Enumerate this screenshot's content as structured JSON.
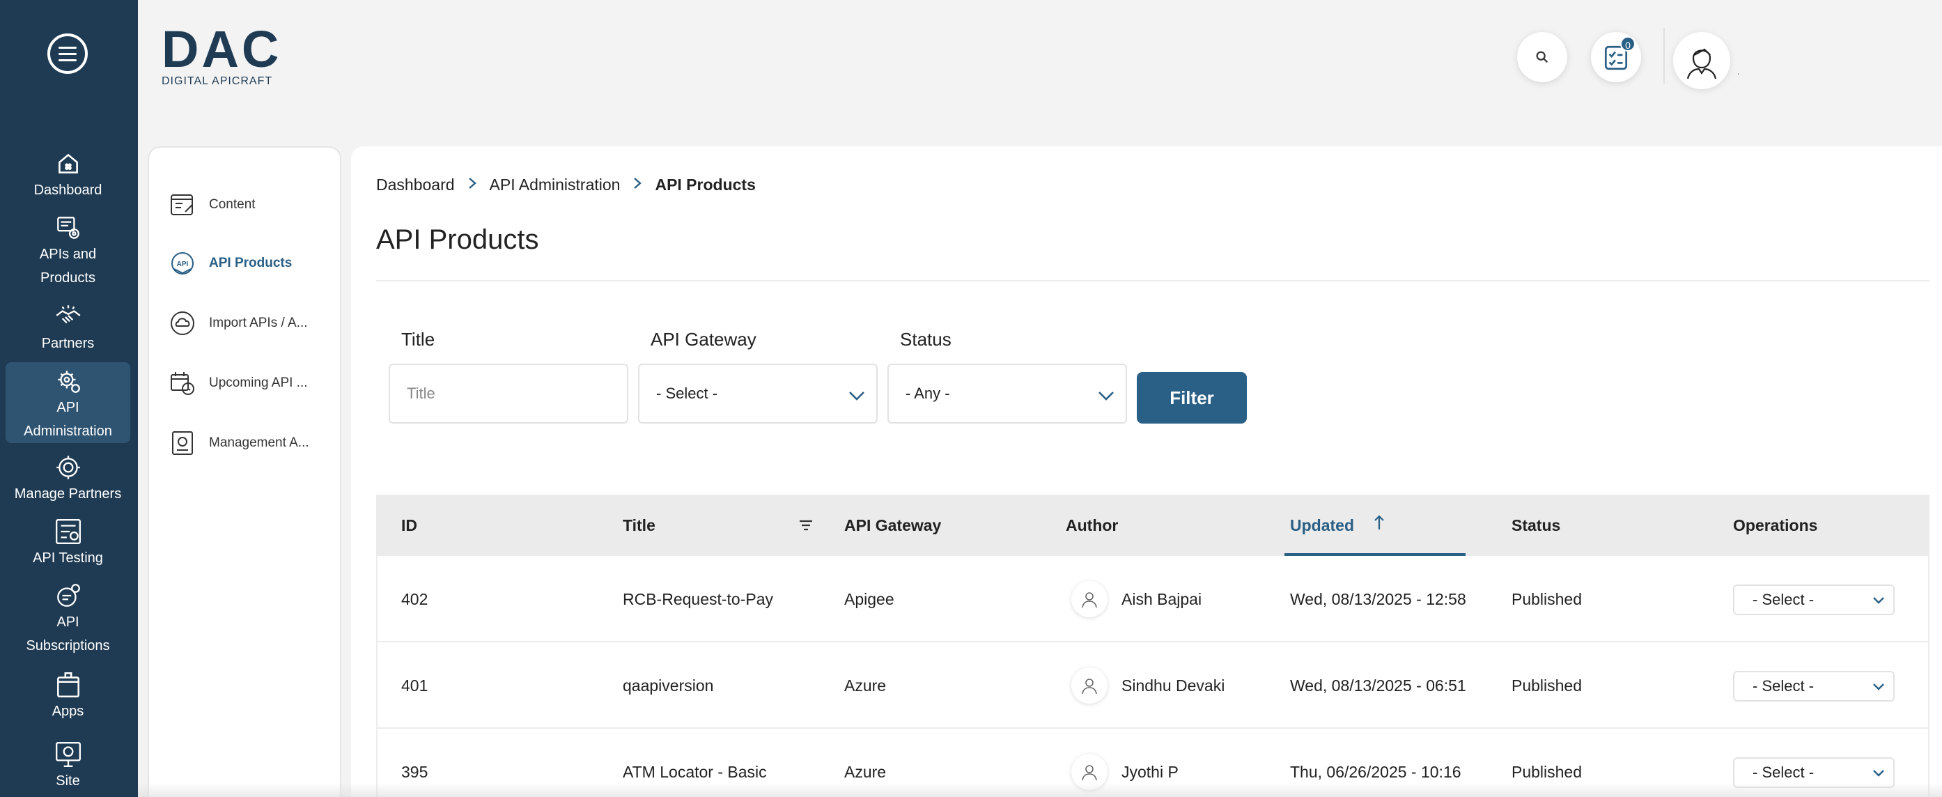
{
  "brand": {
    "logo_text": "DAC",
    "logo_subtext": "DIGITAL APICRAFT"
  },
  "header": {
    "notification_count": "0",
    "user_name": "."
  },
  "leftnav": {
    "items": [
      {
        "label": "Dashboard",
        "icon": "home-icon"
      },
      {
        "label": "APIs and Products",
        "icon": "api-products-icon"
      },
      {
        "label": "Partners",
        "icon": "handshake-icon"
      },
      {
        "label": "API Administration",
        "icon": "api-admin-gear-icon",
        "active": true
      },
      {
        "label": "Manage Partners",
        "icon": "manage-partners-icon"
      },
      {
        "label": "API Testing",
        "icon": "api-testing-icon"
      },
      {
        "label": "API Subscriptions",
        "icon": "subscriptions-icon"
      },
      {
        "label": "Apps",
        "icon": "apps-box-icon"
      },
      {
        "label": "Site",
        "icon": "site-monitor-icon"
      }
    ]
  },
  "subnav": {
    "items": [
      {
        "label": "Content",
        "icon": "content-icon"
      },
      {
        "label": "API Products",
        "icon": "api-badge-icon",
        "active": true
      },
      {
        "label": "Import APIs / A...",
        "icon": "cloud-sync-icon"
      },
      {
        "label": "Upcoming API ...",
        "icon": "calendar-clock-icon"
      },
      {
        "label": "Management A...",
        "icon": "management-doc-icon"
      }
    ]
  },
  "breadcrumb": [
    "Dashboard",
    "API Administration",
    "API Products"
  ],
  "page": {
    "title": "API Products"
  },
  "filters": {
    "title_label": "Title",
    "title_placeholder": "Title",
    "gateway_label": "API Gateway",
    "gateway_value": "- Select -",
    "status_label": "Status",
    "status_value": "- Any -",
    "filter_button": "Filter"
  },
  "table": {
    "columns": [
      "ID",
      "Title",
      "API Gateway",
      "Author",
      "Updated",
      "Status",
      "Operations"
    ],
    "sorted_column": "Updated",
    "sort_direction": "ascending",
    "rows": [
      {
        "id": "402",
        "title": "RCB-Request-to-Pay",
        "gateway": "Apigee",
        "author": "Aish Bajpai",
        "updated": "Wed, 08/13/2025 - 12:58",
        "status": "Published",
        "operation": "- Select -"
      },
      {
        "id": "401",
        "title": "qaapiversion",
        "gateway": "Azure",
        "author": "Sindhu Devaki",
        "updated": "Wed, 08/13/2025 - 06:51",
        "status": "Published",
        "operation": "- Select -"
      },
      {
        "id": "395",
        "title": "ATM Locator - Basic",
        "gateway": "Azure",
        "author": "Jyothi P",
        "updated": "Thu, 06/26/2025 - 10:16",
        "status": "Published",
        "operation": "- Select -"
      }
    ]
  },
  "colors": {
    "nav_bg": "#1f3b53",
    "nav_active": "#2f5472",
    "accent": "#2a5f86"
  }
}
